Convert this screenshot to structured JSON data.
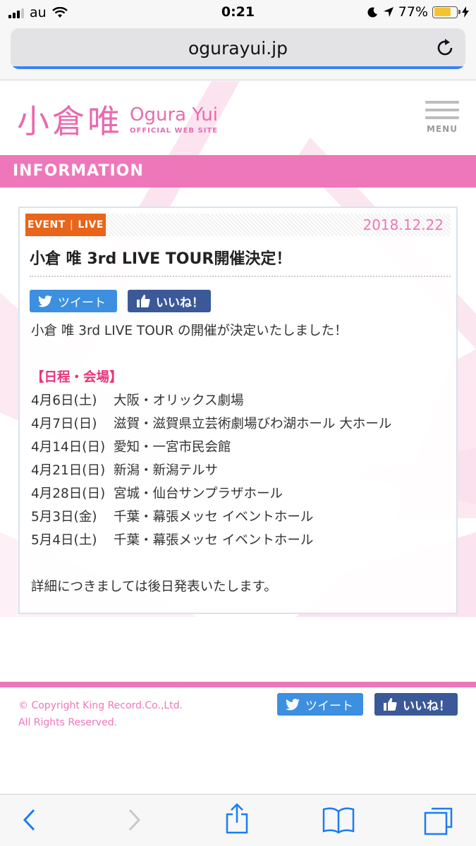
{
  "status_bar": {
    "carrier": "au",
    "time": "0:21",
    "battery": "77%"
  },
  "browser": {
    "url": "ogurayui.jp"
  },
  "site": {
    "logo_kanji": "小倉唯",
    "logo_name": "Ogura Yui",
    "logo_sub": "OFFICIAL WEB SITE",
    "menu_label": "MENU",
    "section_title": "INFORMATION"
  },
  "article": {
    "badge_left": "EVENT",
    "badge_sep": "|",
    "badge_right": "LIVE",
    "date": "2018.12.22",
    "title": "小倉 唯 3rd LIVE TOUR開催決定！",
    "tweet_label": "ツイート",
    "like_label": "いいね！",
    "intro": "小倉 唯 3rd LIVE TOUR の開催が決定いたしました！",
    "schedule_heading": "【日程・会場】",
    "schedule": [
      {
        "date": "4月6日(土)",
        "venue": "大阪・オリックス劇場"
      },
      {
        "date": "4月7日(日)",
        "venue": "滋賀・滋賀県立芸術劇場びわ湖ホール 大ホール"
      },
      {
        "date": "4月14日(日)",
        "venue": "愛知・一宮市民会館"
      },
      {
        "date": "4月21日(日)",
        "venue": "新潟・新潟テルサ"
      },
      {
        "date": "4月28日(日)",
        "venue": "宮城・仙台サンプラザホール"
      },
      {
        "date": "5月3日(金)",
        "venue": "千葉・幕張メッセ イベントホール"
      },
      {
        "date": "5月4日(土)",
        "venue": "千葉・幕張メッセ イベントホール"
      }
    ],
    "closing": "詳細につきましては後日発表いたします。"
  },
  "footer": {
    "copyright_line1": "© Copyright King Record.Co.,Ltd.",
    "copyright_line2": "All Rights Reserved.",
    "tweet_label": "ツイート",
    "like_label": "いいね！"
  },
  "colors": {
    "pink": "#ee77b9",
    "orange": "#e8651a",
    "twitter": "#3d8fe0",
    "facebook": "#3b5998",
    "ios_blue": "#1a7cf5"
  }
}
